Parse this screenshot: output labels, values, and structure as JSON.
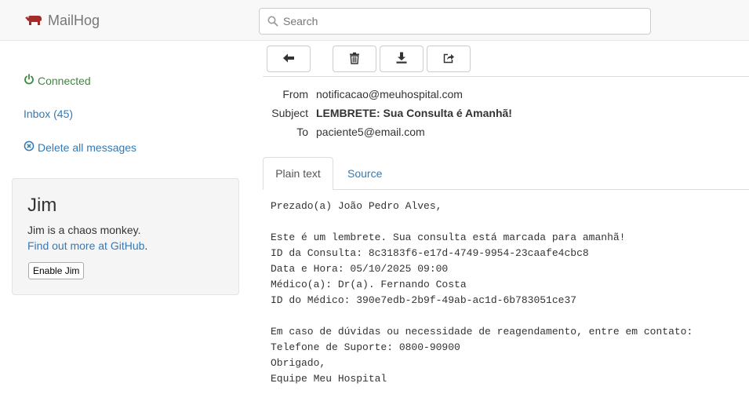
{
  "app": {
    "name": "MailHog"
  },
  "search": {
    "placeholder": "Search"
  },
  "sidebar": {
    "connected_label": "Connected",
    "inbox_label": "Inbox (45)",
    "delete_all_label": "Delete all messages"
  },
  "jim": {
    "title": "Jim",
    "description": "Jim is a chaos monkey.",
    "link_text": "Find out more at GitHub",
    "link_suffix": ".",
    "button_label": "Enable Jim"
  },
  "toolbar": {
    "buttons": [
      "back-arrow-icon",
      "trash-icon",
      "download-icon",
      "release-icon"
    ]
  },
  "message": {
    "from_label": "From",
    "from": "notificacao@meuhospital.com",
    "subject_label": "Subject",
    "subject": "LEMBRETE: Sua Consulta é Amanhã!",
    "to_label": "To",
    "to": "paciente5@email.com",
    "tabs": [
      {
        "label": "Plain text",
        "active": true
      },
      {
        "label": "Source",
        "active": false
      }
    ],
    "body_lines": [
      "Prezado(a) João Pedro Alves,",
      "",
      "Este é um lembrete. Sua consulta está marcada para amanhã!",
      "ID da Consulta: 8c3183f6-e17d-4749-9954-23caafe4cbc8",
      "Data e Hora: 05/10/2025 09:00",
      "Médico(a): Dr(a). Fernando Costa",
      "ID do Médico: 390e7edb-2b9f-49ab-ac1d-6b783051ce37",
      "",
      "Em caso de dúvidas ou necessidade de reagendamento, entre em contato:",
      "Telefone de Suporte: 0800-90900",
      "Obrigado,",
      "Equipe Meu Hospital"
    ]
  },
  "colors": {
    "link": "#337ab7",
    "connected": "#3c8a3c",
    "logo": "#a52a2a"
  }
}
